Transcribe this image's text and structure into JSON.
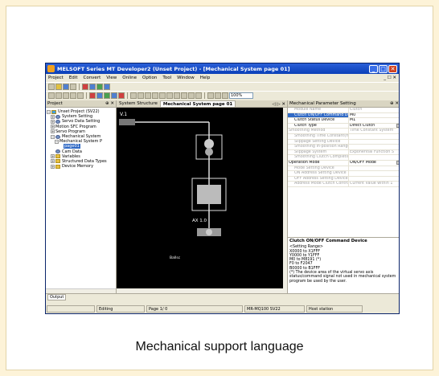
{
  "window": {
    "title": "MELSOFT Series MT Developer2 (Unset Project) - [Mechanical System page 01]",
    "buttons": [
      "_",
      "□",
      "✕"
    ]
  },
  "menu": [
    "Project",
    "Edit",
    "Convert",
    "View",
    "Online",
    "Option",
    "Tool",
    "Window",
    "Help"
  ],
  "menu_right": "_ ☐ ✕",
  "toolbar": {
    "zoom_value": "100%"
  },
  "project_panel": {
    "title": "Project",
    "controls": "⊕ ✕",
    "tree": [
      {
        "label": "Unset Project (SV22)",
        "exp": "−",
        "icon": "root",
        "indent": 0
      },
      {
        "label": "System Setting",
        "exp": "+",
        "icon": "gear",
        "indent": 1
      },
      {
        "label": "Servo Data Setting",
        "exp": "+",
        "icon": "gear",
        "indent": 1
      },
      {
        "label": "Motion SFC Program",
        "exp": "+",
        "icon": "doc",
        "indent": 1
      },
      {
        "label": "Servo Program",
        "exp": "+",
        "icon": "doc",
        "indent": 1
      },
      {
        "label": "Mechanical System",
        "exp": "−",
        "icon": "gear",
        "indent": 1
      },
      {
        "label": "Mechanical System P",
        "exp": "−",
        "icon": "doc",
        "indent": 2
      },
      {
        "label": "page01",
        "exp": "",
        "icon": "doc",
        "indent": 3,
        "selected": true
      },
      {
        "label": "Cam Data",
        "exp": "",
        "icon": "gear",
        "indent": 1
      },
      {
        "label": "Variables",
        "exp": "+",
        "icon": "folder",
        "indent": 1
      },
      {
        "label": "Structured Data Types",
        "exp": "+",
        "icon": "folder",
        "indent": 1
      },
      {
        "label": "Device Memory",
        "exp": "+",
        "icon": "folder",
        "indent": 1
      }
    ]
  },
  "document": {
    "tabs": [
      "System Structure",
      "Mechanical System page 01"
    ],
    "tab_controls": "◁ ▷ ✕",
    "canvas_labels": {
      "axis_top": "V.1",
      "axis_mid": "AX 1.0",
      "bottom": "Ballsc"
    }
  },
  "props_panel": {
    "title": "Mechanical Parameter Setting",
    "controls": "⊕ ✕",
    "rows": [
      {
        "k": "Module Name",
        "v": "Clutch",
        "dim": true
      },
      {
        "k": "Clutch ON/OFF Command Devic",
        "v": "M0",
        "sel": true
      },
      {
        "k": "Clutch Status Device",
        "v": "M1"
      },
      {
        "k": "Clutch Type",
        "v": "Direct Clutch",
        "dd": true
      },
      {
        "k": "Smoothing Method",
        "v": "Time Constant System",
        "grp": true,
        "dim": true
      },
      {
        "k": "Smoothing Time Constant(ms",
        "v": "",
        "dim": true
      },
      {
        "k": "Slippage Setting Device",
        "v": "",
        "dim": true
      },
      {
        "k": "Smoothing In-position Range",
        "v": "",
        "dim": true
      },
      {
        "k": "Slippage System",
        "v": "Exponential Function S",
        "dim": true
      },
      {
        "k": "Smoothing Clutch Completion",
        "v": "",
        "dim": true
      },
      {
        "k": "Operation Mode",
        "v": "ON/OFF Mode",
        "grp": true,
        "dd": true
      },
      {
        "k": "Mode Setting Device",
        "v": "",
        "dim": true
      },
      {
        "k": "ON Address Setting Device",
        "v": "",
        "dim": true
      },
      {
        "k": "OFF Address Setting Device",
        "v": "",
        "dim": true
      },
      {
        "k": "Address Mode Clutch Control",
        "v": "Current Value within 1",
        "dim": true
      }
    ],
    "description": {
      "title": "Clutch ON/OFF Command Device",
      "lines": [
        "<Setting Range>",
        "X0000 to X1FFF",
        "Y0000 to Y1FFF",
        "M0 to M8191 (*)",
        "F0 to F2047",
        "B0000 to B1FFF",
        "(*) The device area of the virtual servo axis status/command signal not used in mechanical system program be used by the user."
      ]
    }
  },
  "output_tab": "Output",
  "statusbar": [
    "Editing",
    "Page 1/ 0",
    "MR-MQ100  SV22",
    "Host station"
  ],
  "caption": "Mechanical support language"
}
